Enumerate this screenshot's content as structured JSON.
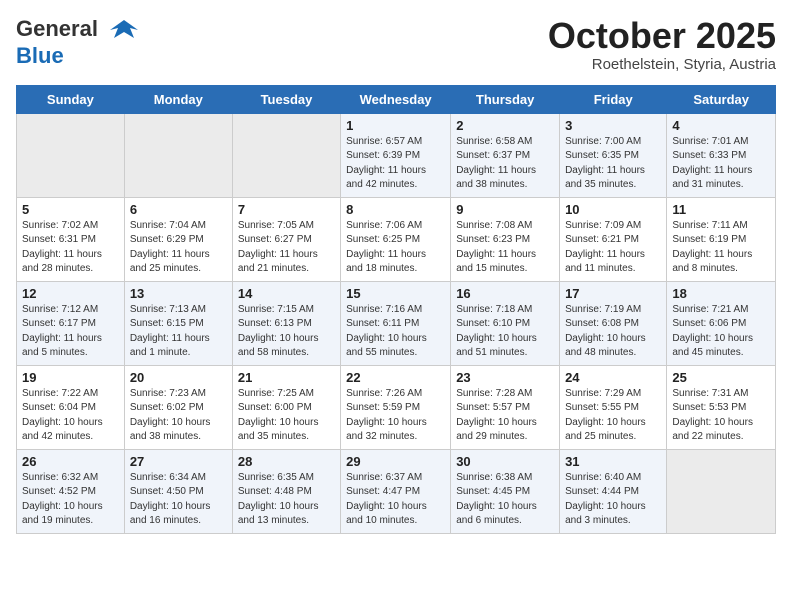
{
  "header": {
    "logo_general": "General",
    "logo_blue": "Blue",
    "month": "October 2025",
    "location": "Roethelstein, Styria, Austria"
  },
  "weekdays": [
    "Sunday",
    "Monday",
    "Tuesday",
    "Wednesday",
    "Thursday",
    "Friday",
    "Saturday"
  ],
  "weeks": [
    [
      {
        "day": "",
        "info": ""
      },
      {
        "day": "",
        "info": ""
      },
      {
        "day": "",
        "info": ""
      },
      {
        "day": "1",
        "info": "Sunrise: 6:57 AM\nSunset: 6:39 PM\nDaylight: 11 hours\nand 42 minutes."
      },
      {
        "day": "2",
        "info": "Sunrise: 6:58 AM\nSunset: 6:37 PM\nDaylight: 11 hours\nand 38 minutes."
      },
      {
        "day": "3",
        "info": "Sunrise: 7:00 AM\nSunset: 6:35 PM\nDaylight: 11 hours\nand 35 minutes."
      },
      {
        "day": "4",
        "info": "Sunrise: 7:01 AM\nSunset: 6:33 PM\nDaylight: 11 hours\nand 31 minutes."
      }
    ],
    [
      {
        "day": "5",
        "info": "Sunrise: 7:02 AM\nSunset: 6:31 PM\nDaylight: 11 hours\nand 28 minutes."
      },
      {
        "day": "6",
        "info": "Sunrise: 7:04 AM\nSunset: 6:29 PM\nDaylight: 11 hours\nand 25 minutes."
      },
      {
        "day": "7",
        "info": "Sunrise: 7:05 AM\nSunset: 6:27 PM\nDaylight: 11 hours\nand 21 minutes."
      },
      {
        "day": "8",
        "info": "Sunrise: 7:06 AM\nSunset: 6:25 PM\nDaylight: 11 hours\nand 18 minutes."
      },
      {
        "day": "9",
        "info": "Sunrise: 7:08 AM\nSunset: 6:23 PM\nDaylight: 11 hours\nand 15 minutes."
      },
      {
        "day": "10",
        "info": "Sunrise: 7:09 AM\nSunset: 6:21 PM\nDaylight: 11 hours\nand 11 minutes."
      },
      {
        "day": "11",
        "info": "Sunrise: 7:11 AM\nSunset: 6:19 PM\nDaylight: 11 hours\nand 8 minutes."
      }
    ],
    [
      {
        "day": "12",
        "info": "Sunrise: 7:12 AM\nSunset: 6:17 PM\nDaylight: 11 hours\nand 5 minutes."
      },
      {
        "day": "13",
        "info": "Sunrise: 7:13 AM\nSunset: 6:15 PM\nDaylight: 11 hours\nand 1 minute."
      },
      {
        "day": "14",
        "info": "Sunrise: 7:15 AM\nSunset: 6:13 PM\nDaylight: 10 hours\nand 58 minutes."
      },
      {
        "day": "15",
        "info": "Sunrise: 7:16 AM\nSunset: 6:11 PM\nDaylight: 10 hours\nand 55 minutes."
      },
      {
        "day": "16",
        "info": "Sunrise: 7:18 AM\nSunset: 6:10 PM\nDaylight: 10 hours\nand 51 minutes."
      },
      {
        "day": "17",
        "info": "Sunrise: 7:19 AM\nSunset: 6:08 PM\nDaylight: 10 hours\nand 48 minutes."
      },
      {
        "day": "18",
        "info": "Sunrise: 7:21 AM\nSunset: 6:06 PM\nDaylight: 10 hours\nand 45 minutes."
      }
    ],
    [
      {
        "day": "19",
        "info": "Sunrise: 7:22 AM\nSunset: 6:04 PM\nDaylight: 10 hours\nand 42 minutes."
      },
      {
        "day": "20",
        "info": "Sunrise: 7:23 AM\nSunset: 6:02 PM\nDaylight: 10 hours\nand 38 minutes."
      },
      {
        "day": "21",
        "info": "Sunrise: 7:25 AM\nSunset: 6:00 PM\nDaylight: 10 hours\nand 35 minutes."
      },
      {
        "day": "22",
        "info": "Sunrise: 7:26 AM\nSunset: 5:59 PM\nDaylight: 10 hours\nand 32 minutes."
      },
      {
        "day": "23",
        "info": "Sunrise: 7:28 AM\nSunset: 5:57 PM\nDaylight: 10 hours\nand 29 minutes."
      },
      {
        "day": "24",
        "info": "Sunrise: 7:29 AM\nSunset: 5:55 PM\nDaylight: 10 hours\nand 25 minutes."
      },
      {
        "day": "25",
        "info": "Sunrise: 7:31 AM\nSunset: 5:53 PM\nDaylight: 10 hours\nand 22 minutes."
      }
    ],
    [
      {
        "day": "26",
        "info": "Sunrise: 6:32 AM\nSunset: 4:52 PM\nDaylight: 10 hours\nand 19 minutes."
      },
      {
        "day": "27",
        "info": "Sunrise: 6:34 AM\nSunset: 4:50 PM\nDaylight: 10 hours\nand 16 minutes."
      },
      {
        "day": "28",
        "info": "Sunrise: 6:35 AM\nSunset: 4:48 PM\nDaylight: 10 hours\nand 13 minutes."
      },
      {
        "day": "29",
        "info": "Sunrise: 6:37 AM\nSunset: 4:47 PM\nDaylight: 10 hours\nand 10 minutes."
      },
      {
        "day": "30",
        "info": "Sunrise: 6:38 AM\nSunset: 4:45 PM\nDaylight: 10 hours\nand 6 minutes."
      },
      {
        "day": "31",
        "info": "Sunrise: 6:40 AM\nSunset: 4:44 PM\nDaylight: 10 hours\nand 3 minutes."
      },
      {
        "day": "",
        "info": ""
      }
    ]
  ]
}
